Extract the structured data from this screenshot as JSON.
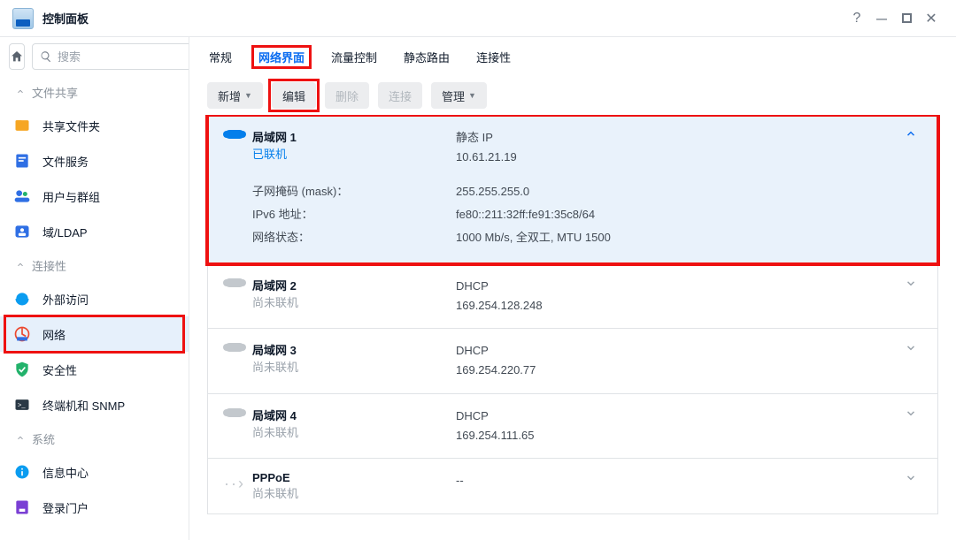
{
  "window": {
    "title": "控制面板"
  },
  "search": {
    "placeholder": "搜索"
  },
  "sidebar": {
    "groups": [
      {
        "label": "文件共享",
        "items": [
          {
            "label": "共享文件夹"
          },
          {
            "label": "文件服务"
          },
          {
            "label": "用户与群组"
          },
          {
            "label": "域/LDAP"
          }
        ]
      },
      {
        "label": "连接性",
        "items": [
          {
            "label": "外部访问"
          },
          {
            "label": "网络",
            "active": true
          },
          {
            "label": "安全性"
          },
          {
            "label": "终端机和 SNMP"
          }
        ]
      },
      {
        "label": "系统",
        "items": [
          {
            "label": "信息中心"
          },
          {
            "label": "登录门户"
          }
        ]
      }
    ]
  },
  "tabs": [
    "常规",
    "网络界面",
    "流量控制",
    "静态路由",
    "连接性"
  ],
  "toolbar": {
    "add": "新增",
    "edit": "编辑",
    "delete": "删除",
    "connect": "连接",
    "manage": "管理"
  },
  "interfaces": [
    {
      "name": "局域网 1",
      "status": "已联机",
      "connected": true,
      "type": "静态 IP",
      "ip": "10.61.21.19",
      "expanded": true,
      "details": [
        {
          "label": "子网掩码 (mask)：",
          "value": "255.255.255.0"
        },
        {
          "label": "IPv6 地址：",
          "value": "fe80::211:32ff:fe91:35c8/64"
        },
        {
          "label": "网络状态：",
          "value": "1000 Mb/s, 全双工, MTU 1500"
        }
      ]
    },
    {
      "name": "局域网 2",
      "status": "尚未联机",
      "connected": false,
      "type": "DHCP",
      "ip": "169.254.128.248"
    },
    {
      "name": "局域网 3",
      "status": "尚未联机",
      "connected": false,
      "type": "DHCP",
      "ip": "169.254.220.77"
    },
    {
      "name": "局域网 4",
      "status": "尚未联机",
      "connected": false,
      "type": "DHCP",
      "ip": "169.254.111.65"
    },
    {
      "name": "PPPoE",
      "status": "尚未联机",
      "connected": false,
      "type": "",
      "ip": "--",
      "pppoe": true
    }
  ]
}
